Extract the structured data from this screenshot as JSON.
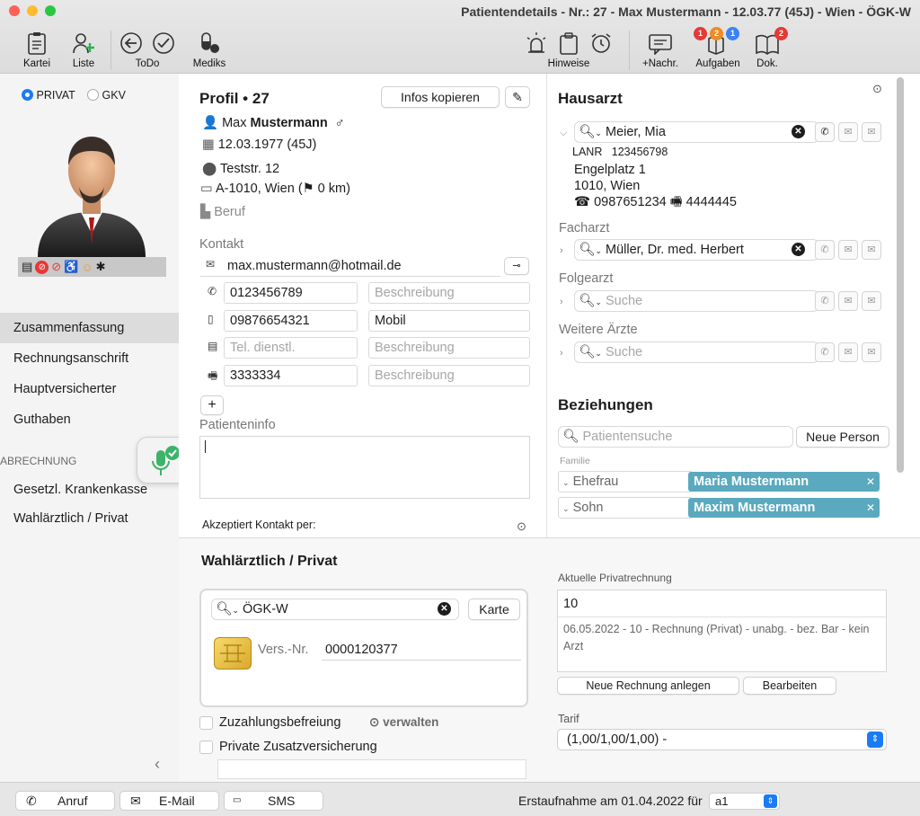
{
  "window": {
    "title": "Patientendetails - Nr.: 27 - Max Mustermann - 12.03.77 (45J) - Wien - ÖGK-W"
  },
  "toolbar": {
    "kartei": "Kartei",
    "liste": "Liste",
    "todo": "ToDo",
    "mediks": "Mediks",
    "hinweise": "Hinweise",
    "nachr": "+Nachr.",
    "aufgaben": "Aufgaben",
    "dok": "Dok.",
    "badges": {
      "aufgaben": [
        "1",
        "2",
        "1"
      ],
      "dok": "2"
    }
  },
  "sidebar": {
    "insurance_options": [
      "PRIVAT",
      "GKV"
    ],
    "selected_insurance": "PRIVAT",
    "nav": [
      "Zusammenfassung",
      "Rechnungsanschrift",
      "Hauptversicherter",
      "Guthaben"
    ],
    "section_header": "ABRECHNUNG",
    "billing_nav": [
      "Gesetzl. Krankenkasse",
      "Wahlärztlich / Privat"
    ],
    "active_item": "Zusammenfassung"
  },
  "profile": {
    "title": "Profil •",
    "number": "27",
    "copy_button": "Infos kopieren",
    "first_name": "Max",
    "last_name": "Mustermann",
    "gender_symbol": "♂",
    "birthdate": "12.03.1977 (45J)",
    "street": "Teststr. 12",
    "city_line": "A-1010, Wien (⚑ 0 km)",
    "job_placeholder": "Beruf"
  },
  "contact": {
    "heading": "Kontakt",
    "email": "max.mustermann@hotmail.de",
    "rows": [
      {
        "icon": "phone-icon",
        "value": "0123456789",
        "desc": "Beschreibung",
        "desc_placeholder": true
      },
      {
        "icon": "mobile-icon",
        "value": "09876654321",
        "desc": "Mobil",
        "desc_placeholder": false
      },
      {
        "icon": "business-card-icon",
        "value": "Tel. dienstl.",
        "value_placeholder": true,
        "desc": "Beschreibung",
        "desc_placeholder": true
      },
      {
        "icon": "fax-icon",
        "value": "3333334",
        "desc": "Beschreibung",
        "desc_placeholder": true
      }
    ],
    "add_label": "+",
    "patient_info_label": "Patienteninfo",
    "accepts_contact": "Akzeptiert Kontakt per:"
  },
  "gp": {
    "heading": "Hausarzt",
    "name": "Meier, Mia",
    "lanr_label": "LANR",
    "lanr": "123456798",
    "street": "Engelplatz 1",
    "city": "1010, Wien",
    "phone": "☎ 0987651234",
    "fax": "4444445",
    "specialist_label": "Facharzt",
    "specialist": "Müller, Dr. med. Herbert",
    "followup_label": "Folgearzt",
    "other_label": "Weitere Ärzte",
    "search_placeholder": "Suche"
  },
  "relations": {
    "heading": "Beziehungen",
    "search_placeholder": "Patientensuche",
    "new_person": "Neue Person",
    "group": "Familie",
    "items": [
      {
        "relation": "Ehefrau",
        "name": "Maria Mustermann"
      },
      {
        "relation": "Sohn",
        "name": "Maxim Mustermann"
      }
    ]
  },
  "private": {
    "heading": "Wahlärztlich / Privat",
    "insurer": "ÖGK-W",
    "card_button": "Karte",
    "insurance_no_label": "Vers.-Nr.",
    "insurance_no": "0000120377",
    "copay_exemption": "Zuzahlungsbefreiung",
    "manage": "verwalten",
    "supplementary": "Private Zusatzversicherung",
    "current_invoice_label": "Aktuelle Privatrechnung",
    "invoice_value": "10",
    "invoice_detail": "06.05.2022 - 10 - Rechnung (Privat) - unabg. - bez. Bar - kein Arzt",
    "new_invoice": "Neue Rechnung anlegen",
    "edit": "Bearbeiten",
    "tariff_label": "Tarif",
    "tariff": "(1,00/1,00/1,00) -"
  },
  "bottom": {
    "call": "Anruf",
    "email": "E-Mail",
    "sms": "SMS",
    "first_visit": "Erstaufnahme am 01.04.2022 für",
    "user": "a1"
  },
  "colors": {
    "accent": "#1a7cf5",
    "relation_tag": "#5aa9bf",
    "badge_red": "#e53935",
    "badge_orange": "#f08a24",
    "badge_blue": "#3b82f6"
  }
}
